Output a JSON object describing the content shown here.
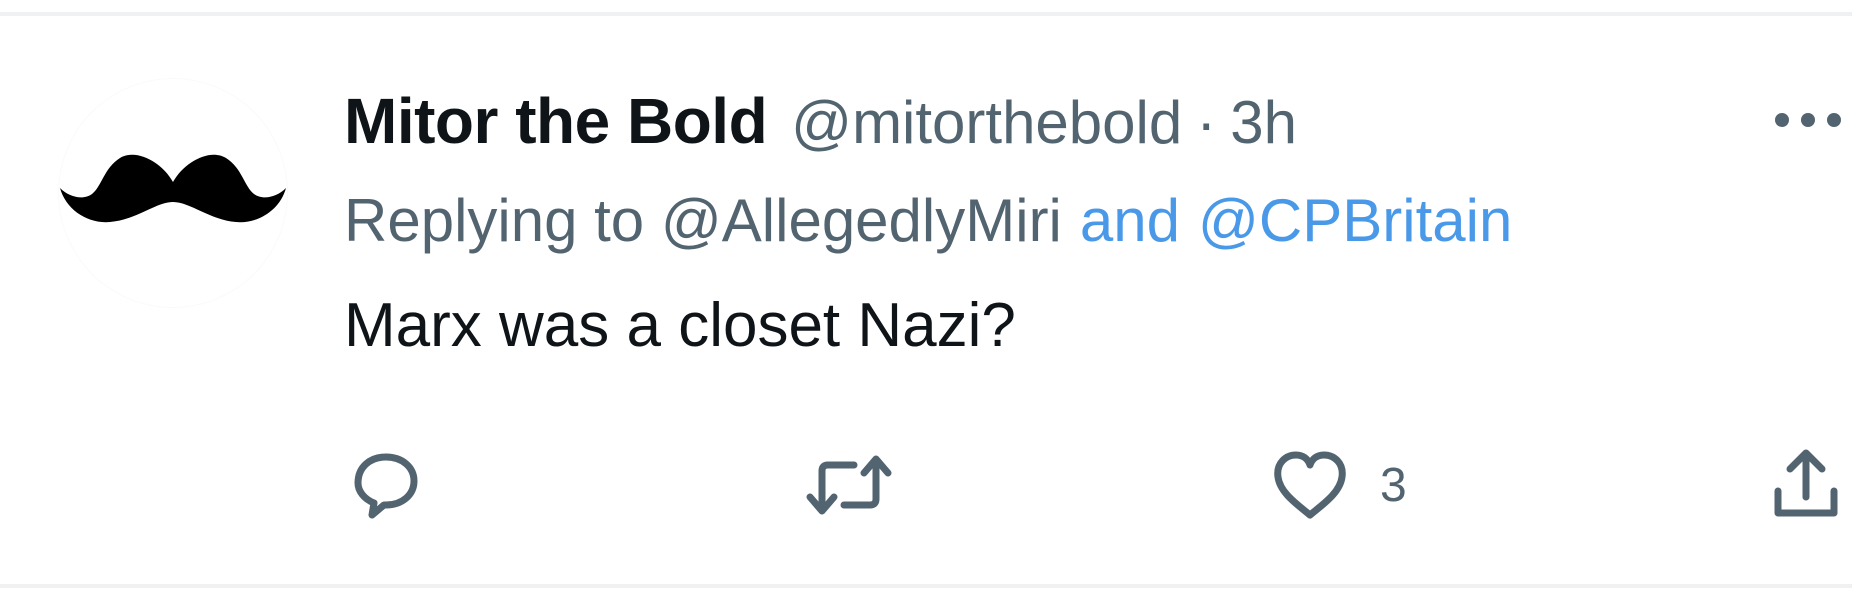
{
  "tweet": {
    "author": {
      "display_name": "Mitor the Bold",
      "handle": "@mitorthebold",
      "avatar_icon": "mustache-icon"
    },
    "separator": "·",
    "timestamp": "3h",
    "reply": {
      "prefix": "Replying to",
      "first_handle": "@AllegedlyMiri",
      "conjunction": "and",
      "second_handle": "@CPBritain"
    },
    "text": "Marx was a closet Nazi?",
    "actions": {
      "reply_icon": "reply-bubble-icon",
      "retweet_icon": "retweet-icon",
      "like_icon": "heart-icon",
      "like_count": "3",
      "share_icon": "share-icon"
    },
    "more_icon": "more-dots-icon"
  },
  "colors": {
    "text_primary": "#0f1419",
    "text_secondary": "#536471",
    "link": "#4a99e9",
    "divider": "#eff1f3"
  }
}
